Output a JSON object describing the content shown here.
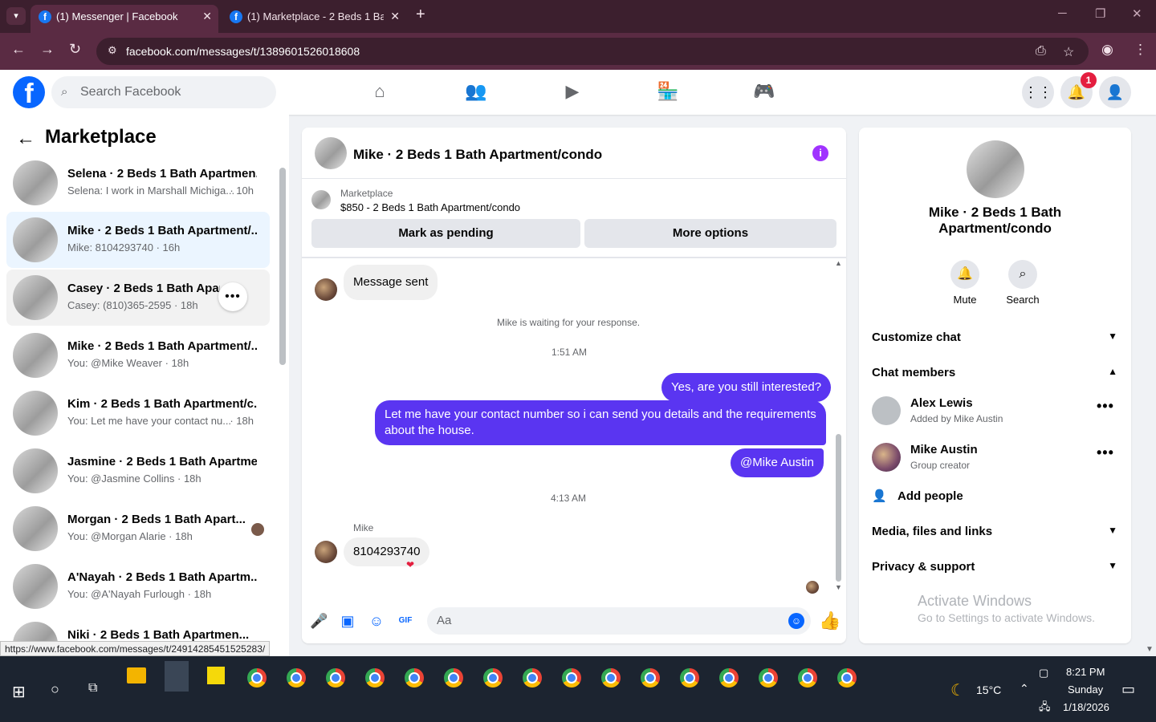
{
  "browser": {
    "tabs": [
      {
        "title": "(1) Messenger | Facebook",
        "active": true
      },
      {
        "title": "(1) Marketplace - 2 Beds 1 Bath",
        "active": false
      }
    ],
    "url": "facebook.com/messages/t/1389601526018608",
    "status_url": "https://www.facebook.com/messages/t/24914285451525283/"
  },
  "header": {
    "search_placeholder": "Search Facebook",
    "notification_count": "1"
  },
  "sidebar": {
    "title": "Marketplace",
    "conversations": [
      {
        "name": "Selena · 2 Beds 1 Bath Apartmen...",
        "preview": "Selena: I work in Marshall Michiga...",
        "time": "· 10h"
      },
      {
        "name": "Mike · 2 Beds 1 Bath Apartment/...",
        "preview": "Mike: 8104293740 · 16h",
        "time": ""
      },
      {
        "name": "Casey · 2 Beds 1 Bath Apartm...",
        "preview": "Casey: (810)365-2595 · 18h",
        "time": ""
      },
      {
        "name": "Mike · 2 Beds 1 Bath Apartment/...",
        "preview": "You: @Mike Weaver · 18h",
        "time": ""
      },
      {
        "name": "Kim · 2 Beds 1 Bath Apartment/c...",
        "preview": "You: Let me have your contact nu...",
        "time": "· 18h"
      },
      {
        "name": "Jasmine · 2 Beds 1 Bath Apartme...",
        "preview": "You: @Jasmine Collins · 18h",
        "time": ""
      },
      {
        "name": "Morgan · 2 Beds 1 Bath Apart...",
        "preview": "You: @Morgan Alarie · 18h",
        "time": ""
      },
      {
        "name": "A'Nayah · 2 Beds 1 Bath Apartm...",
        "preview": "You: @A'Nayah Furlough · 18h",
        "time": ""
      },
      {
        "name": "Niki · 2 Beds 1 Bath Apartmen...",
        "preview": "",
        "time": ""
      }
    ]
  },
  "chat": {
    "title": "Mike · 2 Beds 1 Bath Apartment/condo",
    "marketplace_label": "Marketplace",
    "listing": "$850 - 2 Beds 1 Bath Apartment/condo",
    "mark_pending": "Mark as pending",
    "more_options": "More options",
    "msg_sent": "Message sent",
    "waiting": "Mike is waiting for your response.",
    "time1": "1:51 AM",
    "out1": "Yes, are you still interested?",
    "out2": "Let me have your contact number so i can send you details and the requirements about the house.",
    "out3": "@Mike Austin",
    "time2": "4:13 AM",
    "sender": "Mike",
    "in1": "8104293740",
    "composer_placeholder": "Aa"
  },
  "details": {
    "name": "Mike · 2 Beds 1 Bath Apartment/condo",
    "mute": "Mute",
    "search": "Search",
    "customize": "Customize chat",
    "members_title": "Chat members",
    "members": [
      {
        "name": "Alex Lewis",
        "role": "Added by Mike Austin"
      },
      {
        "name": "Mike Austin",
        "role": "Group creator"
      }
    ],
    "add_people": "Add people",
    "media": "Media, files and links",
    "privacy": "Privacy & support"
  },
  "watermark": {
    "line1": "Activate Windows",
    "line2": "Go to Settings to activate Windows."
  },
  "taskbar": {
    "weather": "15°C",
    "time": "8:21 PM",
    "day": "Sunday",
    "date": "1/18/2026"
  }
}
